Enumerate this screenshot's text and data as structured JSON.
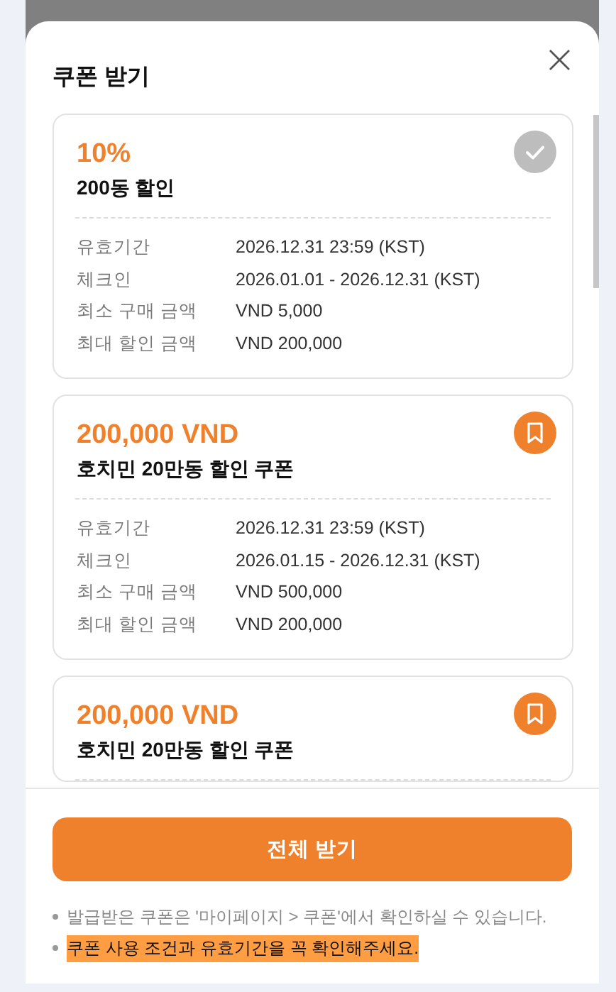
{
  "modal": {
    "title": "쿠폰 받기",
    "close": "×"
  },
  "coupons": [
    {
      "amount": "10%",
      "name": "200동 할인",
      "received": true,
      "details": [
        {
          "label": "유효기간",
          "value": "2026.12.31 23:59 (KST)"
        },
        {
          "label": "체크인",
          "value": "2026.01.01 - 2026.12.31 (KST)"
        },
        {
          "label": "최소 구매 금액",
          "value": "VND 5,000"
        },
        {
          "label": "최대 할인 금액",
          "value": "VND 200,000"
        }
      ]
    },
    {
      "amount": "200,000 VND",
      "name": "호치민 20만동 할인 쿠폰",
      "received": false,
      "details": [
        {
          "label": "유효기간",
          "value": "2026.12.31 23:59 (KST)"
        },
        {
          "label": "체크인",
          "value": "2026.01.15 - 2026.12.31 (KST)"
        },
        {
          "label": "최소 구매 금액",
          "value": "VND 500,000"
        },
        {
          "label": "최대 할인 금액",
          "value": "VND 200,000"
        }
      ]
    },
    {
      "amount": "200,000 VND",
      "name": "호치민 20만동 할인 쿠폰",
      "received": false
    }
  ],
  "button": "전체 받기",
  "notes": [
    {
      "text": "발급받은 쿠폰은 '마이페이지 > 쿠폰'에서 확인하실 수 있습니다.",
      "highlighted": false
    },
    {
      "text": "쿠폰 사용 조건과 유효기간을 꼭 확인해주세요.",
      "highlighted": true
    }
  ]
}
